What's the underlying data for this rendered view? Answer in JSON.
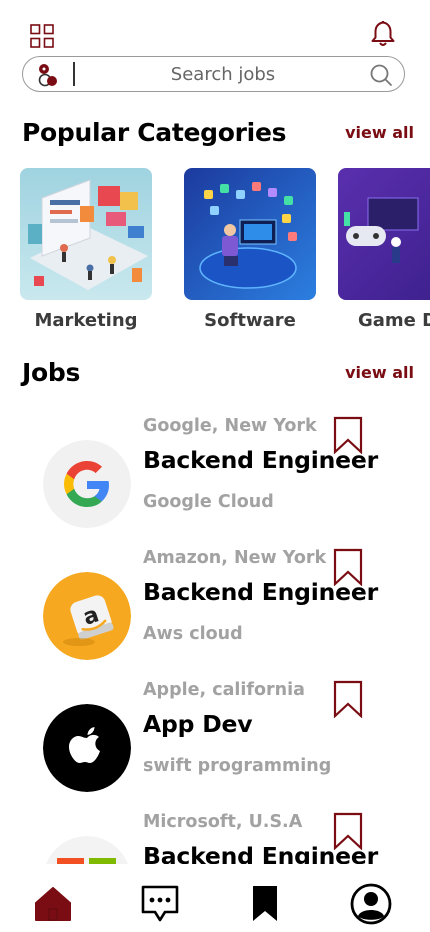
{
  "colors": {
    "accent": "#7a0d13",
    "muted_text": "#a2a2a2",
    "category_label": "#3c3c3c"
  },
  "search": {
    "placeholder": "Search jobs",
    "value": ""
  },
  "categories_section": {
    "title": "Popular Categories",
    "view_all": "view all",
    "items": [
      {
        "label": "Marketing"
      },
      {
        "label": "Software"
      },
      {
        "label": "Game D"
      }
    ]
  },
  "jobs_section": {
    "title": "Jobs",
    "view_all": "view all",
    "items": [
      {
        "company": "Google, New York",
        "title": "Backend Engineer",
        "subtitle": "Google Cloud",
        "logo": "google-logo"
      },
      {
        "company": "Amazon, New York",
        "title": "Backend Engineer",
        "subtitle": "Aws cloud",
        "logo": "amazon-logo"
      },
      {
        "company": "Apple, california",
        "title": "App Dev",
        "subtitle": "swift programming",
        "logo": "apple-logo"
      },
      {
        "company": "Microsoft, U.S.A",
        "title": "Backend Engineer",
        "subtitle": "",
        "logo": "microsoft-logo"
      }
    ]
  },
  "bottom_nav": {
    "items": [
      {
        "icon": "home-icon",
        "active": true
      },
      {
        "icon": "chat-icon",
        "active": false
      },
      {
        "icon": "bookmark-icon",
        "active": false
      },
      {
        "icon": "profile-icon",
        "active": false
      }
    ]
  }
}
